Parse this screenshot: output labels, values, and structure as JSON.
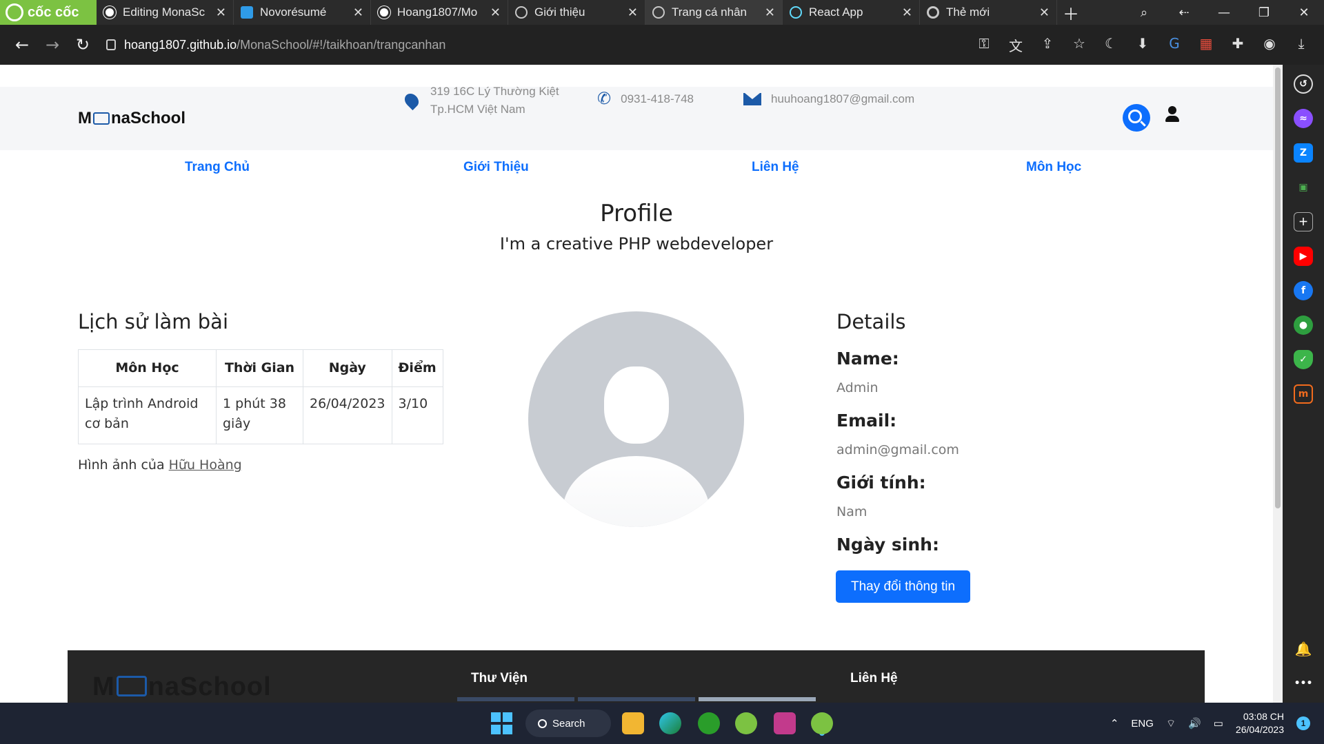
{
  "browser": {
    "brand": "cốc cốc",
    "tabs": [
      {
        "title": "Editing MonaSc",
        "favicon": "github-icon",
        "active": false
      },
      {
        "title": "Novorésumé",
        "favicon": "novoresume-icon",
        "active": false
      },
      {
        "title": "Hoang1807/Mo",
        "favicon": "github-icon",
        "active": false
      },
      {
        "title": "Giới thiệu",
        "favicon": "globe-icon",
        "active": false
      },
      {
        "title": "Trang cá nhân",
        "favicon": "globe-icon",
        "active": true
      },
      {
        "title": "React App",
        "favicon": "react-icon",
        "active": false
      },
      {
        "title": "Thẻ mới",
        "favicon": "coccoc-icon",
        "active": false
      }
    ],
    "close_glyph": "✕",
    "url_host": "hoang1807.github.io",
    "url_path": "/MonaSchool/#!/taikhoan/trangcanhan"
  },
  "site": {
    "logo_prefix": "M",
    "logo_suffix": "naSchool",
    "address_line1": "319 16C Lý Thường Kiệt",
    "address_line2": "Tp.HCM Việt Nam",
    "phone": "0931-418-748",
    "email": "huuhoang1807@gmail.com",
    "nav": [
      "Trang Chủ",
      "Giới Thiệu",
      "Liên Hệ",
      "Môn Học"
    ]
  },
  "profile": {
    "title": "Profile",
    "subtitle": "I'm a creative PHP webdeveloper"
  },
  "history": {
    "title": "Lịch sử làm bài",
    "columns": [
      "Môn Học",
      "Thời Gian",
      "Ngày",
      "Điểm"
    ],
    "rows": [
      [
        "Lập trình Android cơ bản",
        "1 phút 38 giây",
        "26/04/2023",
        "3/10"
      ]
    ],
    "credit_prefix": "Hình ảnh của",
    "credit_link": "Hữu Hoàng"
  },
  "details": {
    "title": "Details",
    "name_label": "Name:",
    "name_value": "Admin",
    "email_label": "Email:",
    "email_value": "admin@gmail.com",
    "gender_label": "Giới tính:",
    "gender_value": "Nam",
    "dob_label": "Ngày sinh:",
    "edit_button": "Thay đổi thông tin"
  },
  "footer": {
    "logo_prefix": "M",
    "logo_suffix": "naSchool",
    "col_library": "Thư Viện",
    "col_contact": "Liên Hệ"
  },
  "taskbar": {
    "search_label": "Search",
    "language": "ENG",
    "time": "03:08 CH",
    "date": "26/04/2023",
    "notifications": "1"
  },
  "colors": {
    "primary": "#0d6efd",
    "brand_green": "#7cc242",
    "logo_blue": "#1c5aa8"
  }
}
